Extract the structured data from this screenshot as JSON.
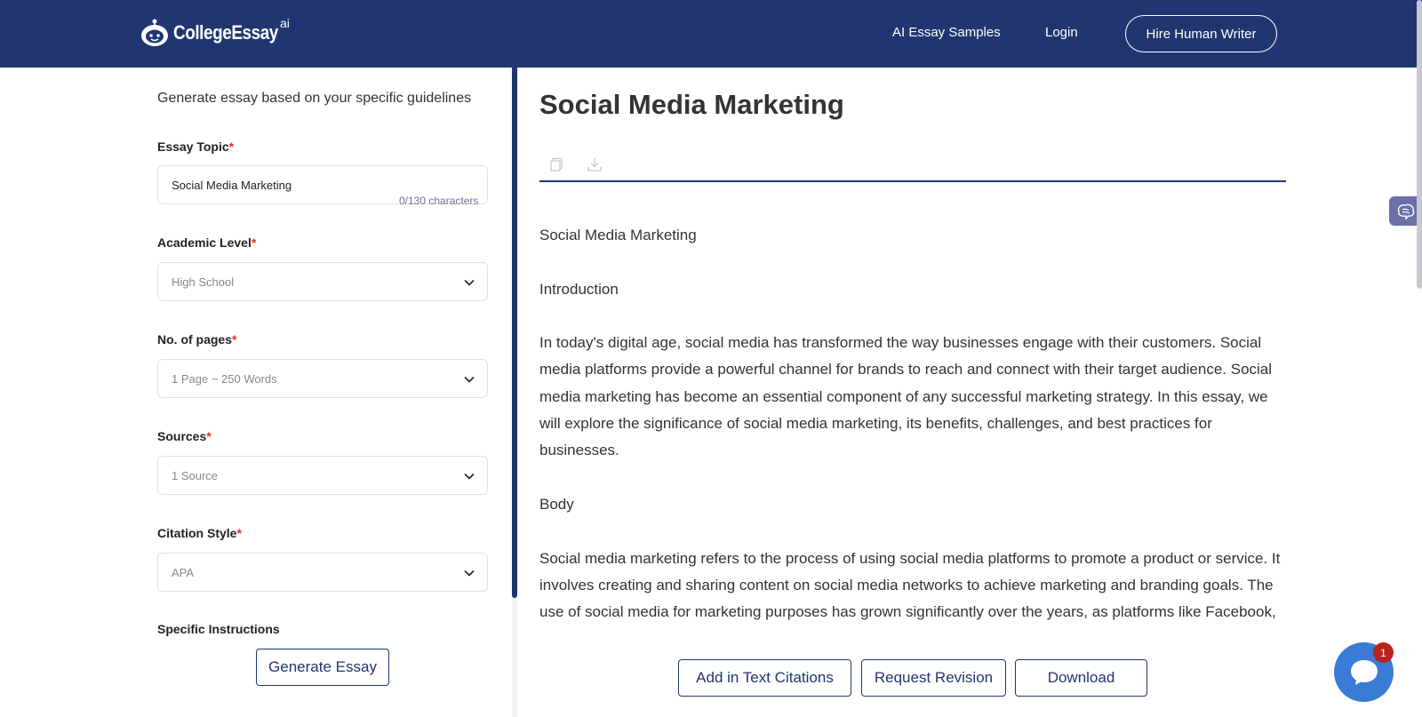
{
  "header": {
    "logo_text": "CollegeEssay",
    "logo_suffix": "ai",
    "nav_samples": "AI Essay Samples",
    "nav_login": "Login",
    "hire_button": "Hire Human Writer"
  },
  "form": {
    "guideline": "Generate essay based on your specific guidelines",
    "topic_label": "Essay Topic",
    "topic_value": "Social Media Marketing",
    "topic_counter": "0/130 characters",
    "level_label": "Academic Level",
    "level_value": "High School",
    "pages_label": "No. of pages",
    "pages_value": "1 Page ~ 250 Words",
    "sources_label": "Sources",
    "sources_value": "1 Source",
    "citation_label": "Citation Style",
    "citation_value": "APA",
    "instructions_label": "Specific Instructions",
    "required_mark": "*",
    "generate_button": "Generate Essay"
  },
  "essay": {
    "title": "Social Media Marketing",
    "paragraphs": [
      "Social Media Marketing",
      "Introduction",
      "In today's digital age, social media has transformed the way businesses engage with their customers. Social media platforms provide a powerful channel for brands to reach and connect with their target audience. Social media marketing has become an essential component of any successful marketing strategy. In this essay, we will explore the significance of social media marketing, its benefits, challenges, and best practices for businesses.",
      "Body",
      "Social media marketing refers to the process of using social media platforms to promote a product or service. It involves creating and sharing content on social media networks to achieve marketing and branding goals. The use of social media for marketing purposes has grown significantly over the years, as platforms like Facebook, Instagram, Twitter, LinkedIn, and TikTok have become integral parts of people's"
    ],
    "cite_button": "Add in Text Citations",
    "revision_button": "Request Revision",
    "download_button": "Download"
  },
  "chat": {
    "badge_count": "1"
  },
  "colors": {
    "brand_navy": "#1f3670",
    "required_red": "#e0312a",
    "chat_blue": "#3a7bd5"
  },
  "icons": [
    "robot-logo-icon",
    "copy-icon",
    "download-icon",
    "chevron-down-icon",
    "brain-icon",
    "chat-icon"
  ]
}
